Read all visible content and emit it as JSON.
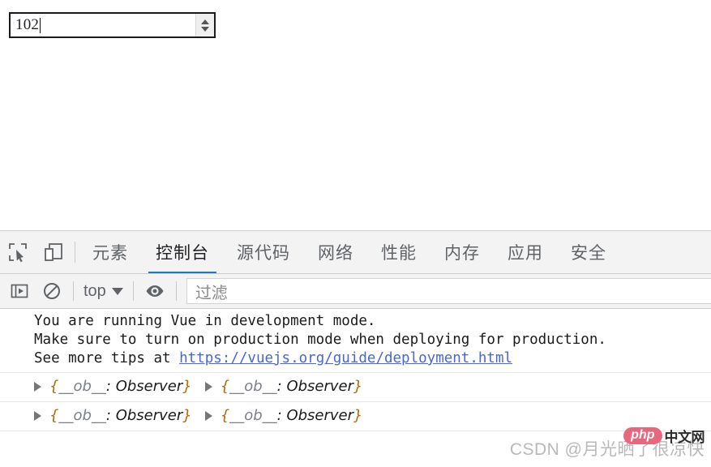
{
  "page": {
    "number_input": {
      "value": "102",
      "spinner_up_icon": "triangle-up-icon",
      "spinner_down_icon": "triangle-down-icon"
    }
  },
  "devtools": {
    "toolbar_icons": [
      {
        "name": "inspect-element-icon",
        "label": "检查元素"
      },
      {
        "name": "device-toolbar-icon",
        "label": "设备工具栏"
      }
    ],
    "tabs": [
      {
        "label": "元素",
        "active": false
      },
      {
        "label": "控制台",
        "active": true
      },
      {
        "label": "源代码",
        "active": false
      },
      {
        "label": "网络",
        "active": false
      },
      {
        "label": "性能",
        "active": false
      },
      {
        "label": "内存",
        "active": false
      },
      {
        "label": "应用",
        "active": false
      },
      {
        "label": "安全",
        "active": false
      }
    ],
    "active_tab_underline_color": "#1a73e8",
    "console_toolbar": {
      "sidebar_toggle_icon": "console-sidebar-icon",
      "clear_console_icon": "clear-console-icon",
      "context": "top",
      "context_caret_icon": "chevron-down-icon",
      "eye_icon": "eye-icon",
      "filter_placeholder": "过滤"
    },
    "console_messages": [
      {
        "type": "text",
        "lines": [
          "You are running Vue in development mode.",
          "Make sure to turn on production mode when deploying for production.",
          "See more tips at "
        ],
        "link": "https://vuejs.org/guide/deployment.html"
      },
      {
        "type": "objects",
        "items": [
          {
            "brace_open": "{",
            "key": "__ob__",
            "colon": ": ",
            "ctor": "Observer",
            "brace_close": "}",
            "expand_icon": "disclosure-triangle-icon"
          },
          {
            "brace_open": "{",
            "key": "__ob__",
            "colon": ": ",
            "ctor": "Observer",
            "brace_close": "}",
            "expand_icon": "disclosure-triangle-icon"
          }
        ]
      },
      {
        "type": "objects",
        "items": [
          {
            "brace_open": "{",
            "key": "__ob__",
            "colon": ": ",
            "ctor": "Observer",
            "brace_close": "}",
            "expand_icon": "disclosure-triangle-icon"
          },
          {
            "brace_open": "{",
            "key": "__ob__",
            "colon": ": ",
            "ctor": "Observer",
            "brace_close": "}",
            "expand_icon": "disclosure-triangle-icon"
          }
        ]
      }
    ]
  },
  "watermark": {
    "text": "CSDN @月光晒了很凉快",
    "logo_php": "php",
    "logo_cn": "中文网"
  }
}
